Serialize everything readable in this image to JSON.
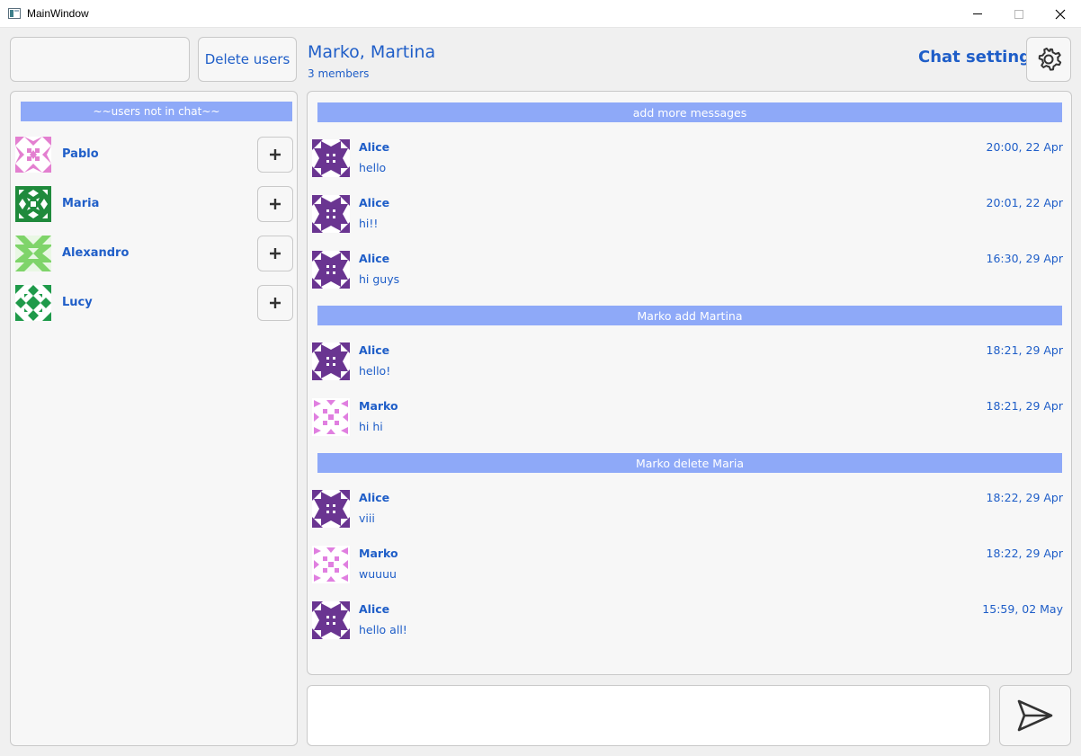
{
  "window": {
    "title": "MainWindow"
  },
  "toolbar": {
    "search_value": "",
    "delete_users_label": "Delete users",
    "chat_settings_label": "Chat settings"
  },
  "chat": {
    "title": "Marko, Martina",
    "members": "3 members"
  },
  "users_panel": {
    "header": "~~users not in chat~~",
    "users": [
      {
        "name": "Pablo",
        "avatar": "pablo-avatar-icon",
        "avatar_color": "#e37fd0"
      },
      {
        "name": "Maria",
        "avatar": "maria-avatar-icon",
        "avatar_color": "#1f8a3c"
      },
      {
        "name": "Alexandro",
        "avatar": "alexandro-avatar-icon",
        "avatar_color": "#7fd46a"
      },
      {
        "name": "Lucy",
        "avatar": "lucy-avatar-icon",
        "avatar_color": "#1f9a4a"
      }
    ],
    "add_icon": "plus-icon"
  },
  "messages": {
    "load_more_label": "add more messages",
    "items": [
      {
        "kind": "message",
        "author": "Alice",
        "text": "hello",
        "time": "20:00, 22 Apr"
      },
      {
        "kind": "message",
        "author": "Alice",
        "text": "hi!!",
        "time": "20:01, 22 Apr"
      },
      {
        "kind": "message",
        "author": "Alice",
        "text": "hi guys",
        "time": "16:30, 29 Apr"
      },
      {
        "kind": "system",
        "text": "Marko add Martina"
      },
      {
        "kind": "message",
        "author": "Alice",
        "text": "hello!",
        "time": "18:21, 29 Apr"
      },
      {
        "kind": "message",
        "author": "Marko",
        "text": "hi hi",
        "time": "18:21, 29 Apr"
      },
      {
        "kind": "system",
        "text": "Marko delete Maria"
      },
      {
        "kind": "message",
        "author": "Alice",
        "text": "viii",
        "time": "18:22, 29 Apr"
      },
      {
        "kind": "message",
        "author": "Marko",
        "text": "wuuuu",
        "time": "18:22, 29 Apr"
      },
      {
        "kind": "message",
        "author": "Alice",
        "text": "hello all!",
        "time": "15:59, 02 May"
      }
    ]
  },
  "composer": {
    "value": "",
    "send_icon": "send-icon"
  },
  "colors": {
    "accent": "#1f5ec8",
    "system_bar": "#8ea9f8",
    "alice_avatar": "#6a3591",
    "marko_avatar": "#e07fe0"
  }
}
